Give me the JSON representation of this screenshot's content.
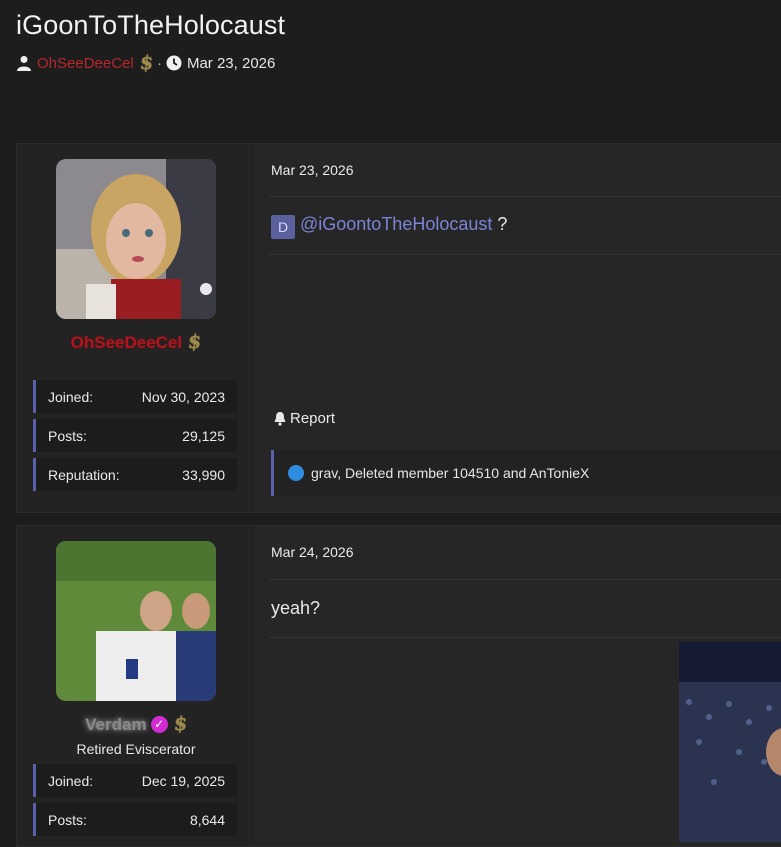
{
  "thread": {
    "title": "iGoonToTheHolocaust",
    "author": "OhSeeDeeCel",
    "date": "Mar 23, 2026"
  },
  "posts": [
    {
      "user": {
        "name": "OhSeeDeeCel",
        "joined_label": "Joined:",
        "joined": "Nov 30, 2023",
        "posts_label": "Posts:",
        "posts": "29,125",
        "rep_label": "Reputation:",
        "rep": "33,990"
      },
      "date": "Mar 23, 2026",
      "mention_initial": "D",
      "mention": "@iGoontoTheHolocaust",
      "after_mention": " ?",
      "report": "Report",
      "reactions": "grav, Deleted member 104510 and AnTonieX"
    },
    {
      "user": {
        "name": "Verdam",
        "title": "Retired Eviscerator",
        "joined_label": "Joined:",
        "joined": "Dec 19, 2025",
        "posts_label": "Posts:",
        "posts": "8,644"
      },
      "date": "Mar 24, 2026",
      "body": "yeah?"
    }
  ],
  "icons": {
    "user": "user-icon",
    "clock": "clock-icon",
    "dollar": "dollar-badge-icon",
    "bell": "bell-icon",
    "like": "like-icon",
    "verified": "verified-check-icon"
  },
  "colors": {
    "background": "#1d1d1d",
    "author_red": "#b8262b",
    "mention_blue": "#7b84d6",
    "accent_bar": "#5a5fae",
    "verified_magenta": "#d32bd3"
  }
}
